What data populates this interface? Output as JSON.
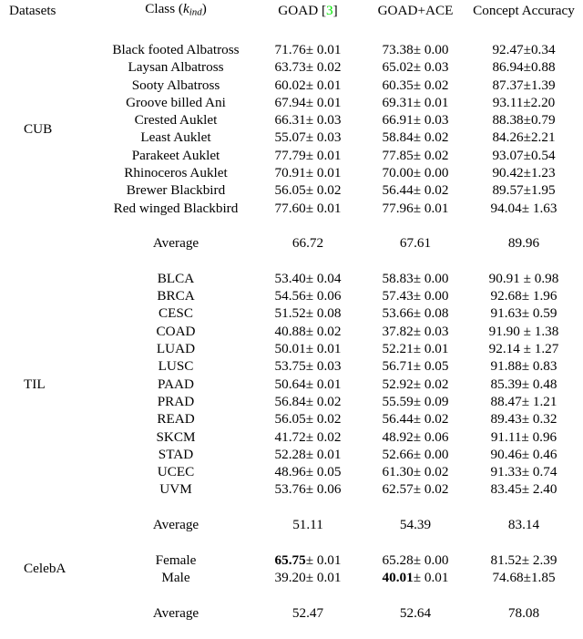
{
  "table": {
    "columns": [
      {
        "key": "datasets",
        "label": "Datasets"
      },
      {
        "key": "class",
        "label": "Class (k_ind)",
        "label_main": "Class (",
        "label_sub": "k",
        "label_sub_idx": "ind",
        "label_tail": ")"
      },
      {
        "key": "goad",
        "label": "GOAD [3]",
        "label_main": "GOAD [",
        "citation": "3",
        "label_tail": "]",
        "citation_color": "#00e800"
      },
      {
        "key": "goad_ace",
        "label": "GOAD+ACE"
      },
      {
        "key": "concept_accuracy",
        "label": "Concept Accuracy"
      }
    ],
    "groups": [
      {
        "dataset": "CUB",
        "rows": [
          {
            "class": "Black footed Albatross",
            "goad": "71.76± 0.01",
            "goad_ace": "73.38± 0.00",
            "concept_accuracy": "92.47±0.34"
          },
          {
            "class": "Laysan Albatross",
            "goad": "63.73± 0.02",
            "goad_ace": "65.02± 0.03",
            "concept_accuracy": "86.94±0.88"
          },
          {
            "class": "Sooty Albatross",
            "goad": "60.02± 0.01",
            "goad_ace": "60.35± 0.02",
            "concept_accuracy": "87.37±1.39"
          },
          {
            "class": "Groove billed Ani",
            "goad": "67.94± 0.01",
            "goad_ace": "69.31± 0.01",
            "concept_accuracy": "93.11±2.20"
          },
          {
            "class": "Crested Auklet",
            "goad": "66.31± 0.03",
            "goad_ace": "66.91± 0.03",
            "concept_accuracy": "88.38±0.79"
          },
          {
            "class": "Least Auklet",
            "goad": "55.07± 0.03",
            "goad_ace": "58.84± 0.02",
            "concept_accuracy": "84.26±2.21"
          },
          {
            "class": "Parakeet Auklet",
            "goad": "77.79± 0.01",
            "goad_ace": "77.85± 0.02",
            "concept_accuracy": "93.07±0.54"
          },
          {
            "class": "Rhinoceros Auklet",
            "goad": "70.91± 0.01",
            "goad_ace": "70.00± 0.00",
            "concept_accuracy": "90.42±1.23"
          },
          {
            "class": "Brewer Blackbird",
            "goad": "56.05± 0.02",
            "goad_ace": "56.44± 0.02",
            "concept_accuracy": "89.57±1.95"
          },
          {
            "class": "Red winged Blackbird",
            "goad": "77.60± 0.01",
            "goad_ace": "77.96± 0.01",
            "concept_accuracy": "94.04± 1.63"
          }
        ],
        "average": {
          "class": "Average",
          "goad": "66.72",
          "goad_ace": "67.61",
          "goad_ace_bold": true,
          "concept_accuracy": "89.96"
        }
      },
      {
        "dataset": "TIL",
        "rows": [
          {
            "class": "BLCA",
            "goad": "53.40± 0.04",
            "goad_ace": "58.83± 0.00",
            "concept_accuracy": "90.91 ± 0.98"
          },
          {
            "class": "BRCA",
            "goad": "54.56± 0.06",
            "goad_ace": "57.43± 0.00",
            "concept_accuracy": "92.68± 1.96"
          },
          {
            "class": "CESC",
            "goad": "51.52± 0.08",
            "goad_ace": "53.66± 0.08",
            "concept_accuracy": "91.63± 0.59"
          },
          {
            "class": "COAD",
            "goad": "40.88± 0.02",
            "goad_ace": "37.82± 0.03",
            "concept_accuracy": "91.90 ± 1.38"
          },
          {
            "class": "LUAD",
            "goad": "50.01± 0.01",
            "goad_ace": "52.21± 0.01",
            "concept_accuracy": "92.14 ± 1.27"
          },
          {
            "class": "LUSC",
            "goad": "53.75± 0.03",
            "goad_ace": "56.71± 0.05",
            "concept_accuracy": "91.88± 0.83"
          },
          {
            "class": "PAAD",
            "goad": "50.64± 0.01",
            "goad_ace": "52.92± 0.02",
            "concept_accuracy": "85.39± 0.48"
          },
          {
            "class": "PRAD",
            "goad": "56.84± 0.02",
            "goad_ace": "55.59± 0.09",
            "concept_accuracy": "88.47± 1.21"
          },
          {
            "class": "READ",
            "goad": "56.05± 0.02",
            "goad_ace": "56.44± 0.02",
            "concept_accuracy": "89.43± 0.32"
          },
          {
            "class": "SKCM",
            "goad": "41.72± 0.02",
            "goad_ace": "48.92± 0.06",
            "concept_accuracy": "91.11± 0.96"
          },
          {
            "class": "STAD",
            "goad": "52.28± 0.01",
            "goad_ace": "52.66± 0.00",
            "concept_accuracy": "90.46± 0.46"
          },
          {
            "class": "UCEC",
            "goad": "48.96± 0.05",
            "goad_ace": "61.30± 0.02",
            "concept_accuracy": "91.33± 0.74"
          },
          {
            "class": "UVM",
            "goad": "53.76± 0.06",
            "goad_ace": "62.57± 0.02",
            "concept_accuracy": "83.45± 2.40"
          }
        ],
        "average": {
          "class": "Average",
          "goad": "51.11",
          "goad_ace": "54.39",
          "goad_ace_bold": true,
          "concept_accuracy": "83.14"
        }
      },
      {
        "dataset": "CelebA",
        "rows": [
          {
            "class": "Female",
            "goad": "65.75± 0.01",
            "goad_bold_part": "65.75",
            "goad_bold": true,
            "goad_ace": "65.28± 0.00",
            "concept_accuracy": "81.52± 2.39"
          },
          {
            "class": "Male",
            "goad": "39.20± 0.01",
            "goad_ace": "40.01± 0.01",
            "goad_ace_bold_part": "40.01",
            "goad_ace_bold": true,
            "concept_accuracy": "74.68±1.85"
          }
        ],
        "average": {
          "class": "Average",
          "goad": "52.47",
          "goad_ace": "52.64",
          "goad_ace_bold": true,
          "concept_accuracy": "78.08"
        }
      }
    ]
  }
}
